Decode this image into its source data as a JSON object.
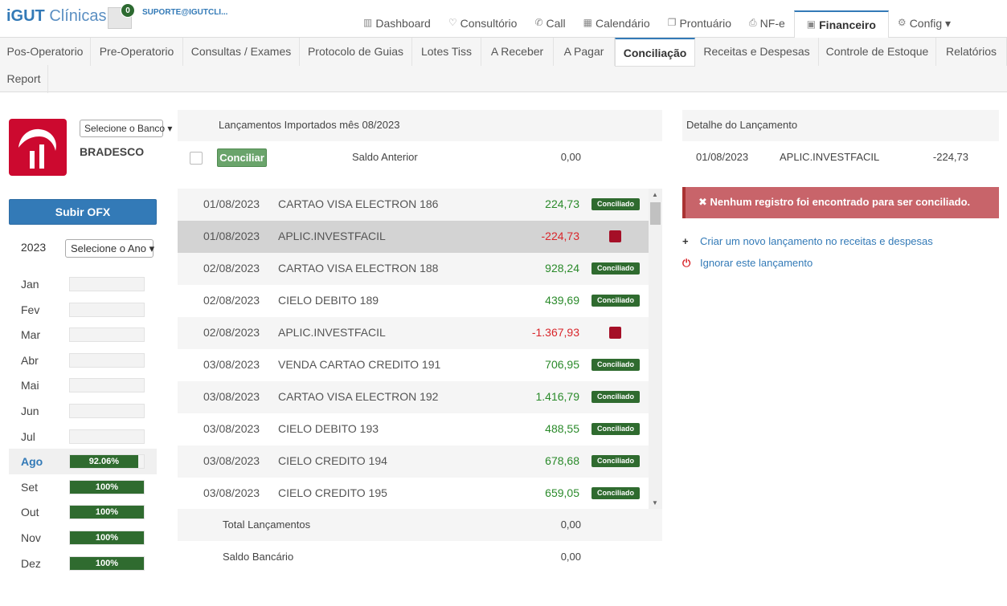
{
  "header": {
    "logo_bold": "iGUT",
    "logo_light": "Clínicas",
    "notification_count": "0",
    "user": "SUPORTE@IGUTCLI...",
    "nav": [
      {
        "icon": "▥",
        "label": "Dashboard"
      },
      {
        "icon": "♡",
        "label": "Consultório"
      },
      {
        "icon": "✆",
        "label": "Call"
      },
      {
        "icon": "▦",
        "label": "Calendário"
      },
      {
        "icon": "❐",
        "label": "Prontuário"
      },
      {
        "icon": "⎙",
        "label": "NF-e"
      },
      {
        "icon": "▣",
        "label": "Financeiro"
      },
      {
        "icon": "⚙",
        "label": "Config ▾"
      }
    ]
  },
  "tabs": [
    "Pos-Operatorio",
    "Pre-Operatorio",
    "Consultas / Exames",
    "Protocolo de Guias",
    "Lotes Tiss",
    "A Receber",
    "A Pagar",
    "Conciliação",
    "Receitas e Despesas",
    "Controle de Estoque",
    "Relatórios",
    "Report"
  ],
  "left": {
    "bank_select": "Selecione o Banco ▾",
    "bank_name": "BRADESCO",
    "upload_button": "Subir OFX",
    "year": "2023",
    "year_select": "Selecione o Ano ▾",
    "months": [
      {
        "name": "Jan",
        "pct": 0,
        "label": ""
      },
      {
        "name": "Fev",
        "pct": 0,
        "label": ""
      },
      {
        "name": "Mar",
        "pct": 0,
        "label": ""
      },
      {
        "name": "Abr",
        "pct": 0,
        "label": ""
      },
      {
        "name": "Mai",
        "pct": 0,
        "label": ""
      },
      {
        "name": "Jun",
        "pct": 0,
        "label": ""
      },
      {
        "name": "Jul",
        "pct": 0,
        "label": ""
      },
      {
        "name": "Ago",
        "pct": 92.06,
        "label": "92.06%"
      },
      {
        "name": "Set",
        "pct": 100,
        "label": "100%"
      },
      {
        "name": "Out",
        "pct": 100,
        "label": "100%"
      },
      {
        "name": "Nov",
        "pct": 100,
        "label": "100%"
      },
      {
        "name": "Dez",
        "pct": 100,
        "label": "100%"
      }
    ]
  },
  "middle": {
    "title": "Lançamentos Importados mês 08/2023",
    "conciliar_button": "Conciliar",
    "saldo_anterior_label": "Saldo Anterior",
    "saldo_anterior_value": "0,00",
    "status_label": "Conciliado",
    "rows": [
      {
        "date": "01/08/2023",
        "desc": "CARTAO VISA ELECTRON 186",
        "value": "224,73",
        "sign": "pos",
        "status": "conciliado"
      },
      {
        "date": "01/08/2023",
        "desc": "APLIC.INVESTFACIL",
        "value": "-224,73",
        "sign": "neg",
        "status": "pending"
      },
      {
        "date": "02/08/2023",
        "desc": "CARTAO VISA ELECTRON 188",
        "value": "928,24",
        "sign": "pos",
        "status": "conciliado"
      },
      {
        "date": "02/08/2023",
        "desc": "CIELO DEBITO 189",
        "value": "439,69",
        "sign": "pos",
        "status": "conciliado"
      },
      {
        "date": "02/08/2023",
        "desc": "APLIC.INVESTFACIL",
        "value": "-1.367,93",
        "sign": "neg",
        "status": "pending"
      },
      {
        "date": "03/08/2023",
        "desc": "VENDA CARTAO CREDITO 191",
        "value": "706,95",
        "sign": "pos",
        "status": "conciliado"
      },
      {
        "date": "03/08/2023",
        "desc": "CARTAO VISA ELECTRON 192",
        "value": "1.416,79",
        "sign": "pos",
        "status": "conciliado"
      },
      {
        "date": "03/08/2023",
        "desc": "CIELO DEBITO 193",
        "value": "488,55",
        "sign": "pos",
        "status": "conciliado"
      },
      {
        "date": "03/08/2023",
        "desc": "CIELO CREDITO 194",
        "value": "678,68",
        "sign": "pos",
        "status": "conciliado"
      },
      {
        "date": "03/08/2023",
        "desc": "CIELO CREDITO 195",
        "value": "659,05",
        "sign": "pos",
        "status": "conciliado"
      }
    ],
    "selected_row": 1,
    "total_label": "Total Lançamentos",
    "total_value": "0,00",
    "saldo_bancario_label": "Saldo Bancário",
    "saldo_bancario_value": "0,00"
  },
  "detail": {
    "title": "Detalhe do Lançamento",
    "date": "01/08/2023",
    "desc": "APLIC.INVESTFACIL",
    "value": "-224,73",
    "alert": "✖  Nenhum registro foi encontrado para ser conciliado.",
    "create_link": "Criar um novo lançamento no receitas e despesas",
    "ignore_link": "Ignorar este lançamento"
  },
  "colors": {
    "accent": "#337ab7",
    "success": "#2f6b2f",
    "danger": "#a50f27",
    "bank": "#cc092f"
  }
}
